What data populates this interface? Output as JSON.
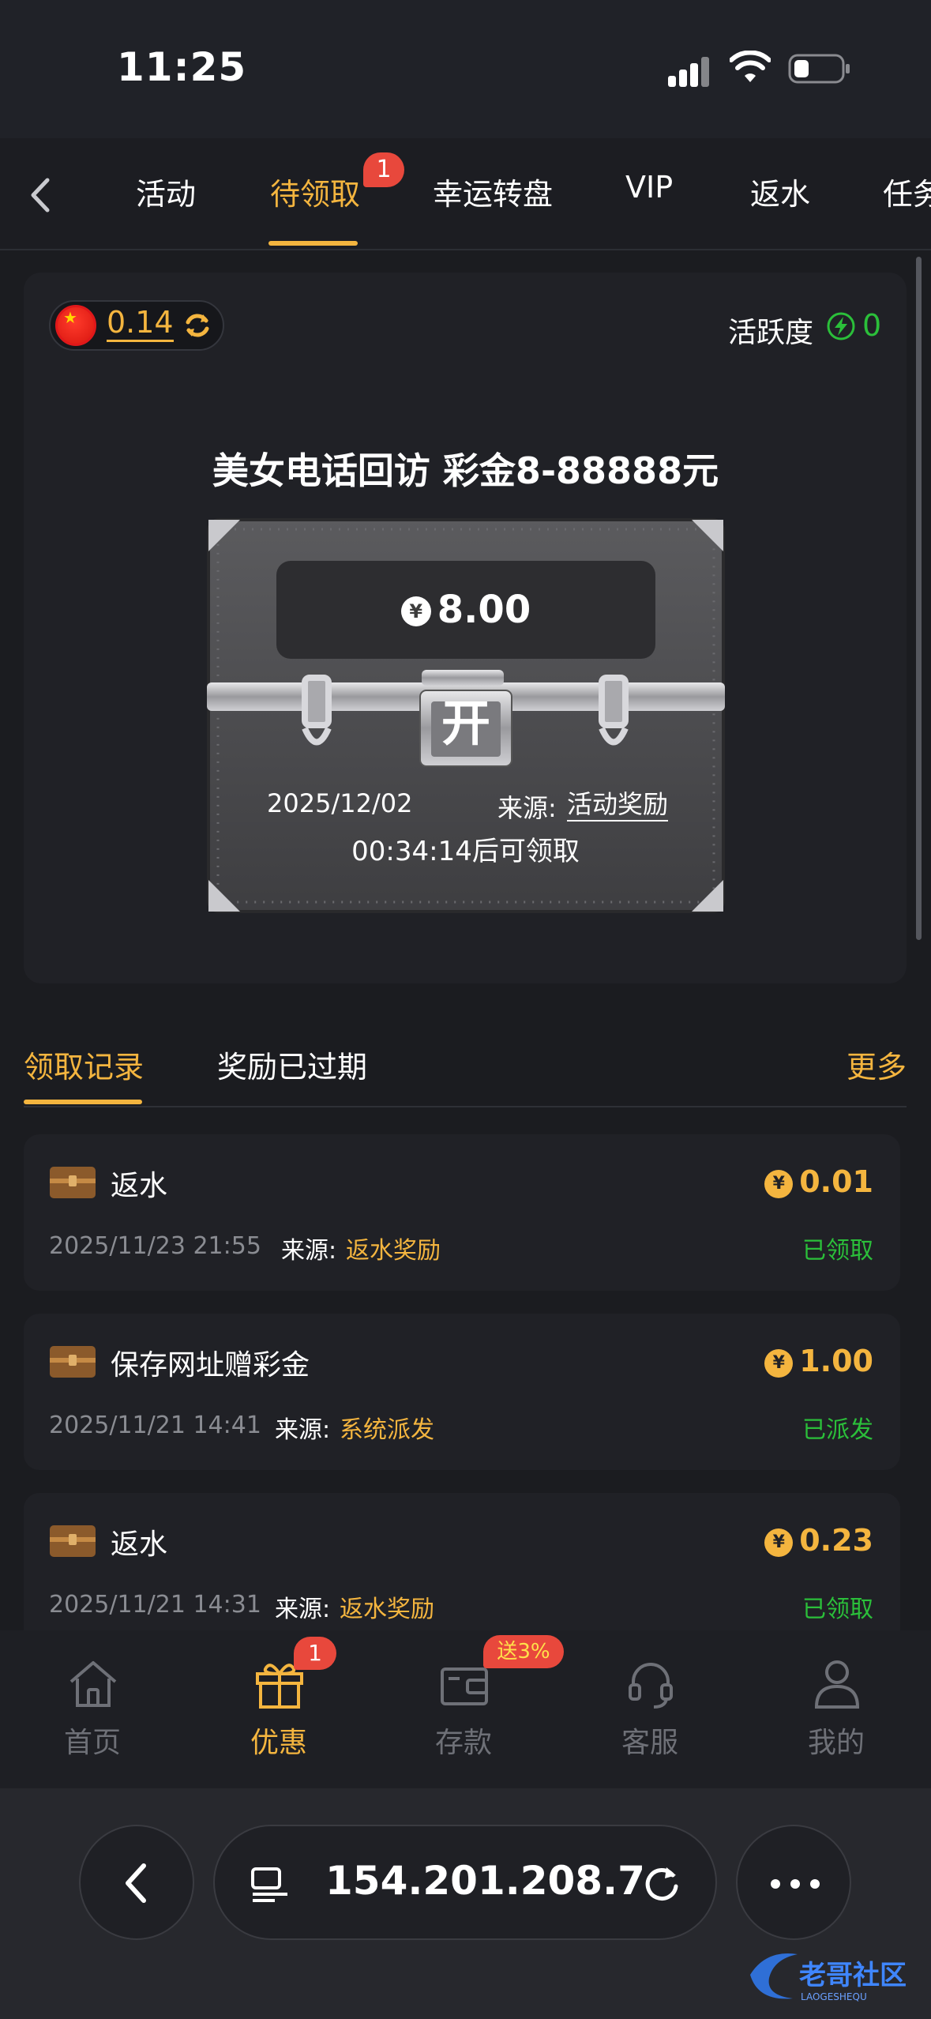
{
  "status_bar": {
    "time": "11:25"
  },
  "nav": {
    "tabs": [
      {
        "label": "活动"
      },
      {
        "label": "待领取",
        "badge": "1",
        "active": true
      },
      {
        "label": "幸运转盘"
      },
      {
        "label": "VIP"
      },
      {
        "label": "返水"
      },
      {
        "label": "任务"
      }
    ]
  },
  "wallet": {
    "balance": "0.14",
    "activity_label": "活跃度",
    "activity_value": "0"
  },
  "chest": {
    "title": "美女电话回访 彩金8-88888元",
    "currency_symbol": "¥",
    "amount": "8.00",
    "open_label": "开",
    "date": "2025/12/02",
    "source_label": "来源:",
    "source_value": "活动奖励",
    "countdown": "00:34:14后可领取"
  },
  "records_tabs": {
    "claimed": "领取记录",
    "expired": "奖励已过期",
    "more": "更多"
  },
  "records": [
    {
      "title": "返水",
      "amount": "0.01",
      "time": "2025/11/23 21:55",
      "source_label": "来源:",
      "source_value": "返水奖励",
      "status": "已领取"
    },
    {
      "title": "保存网址赠彩金",
      "amount": "1.00",
      "time": "2025/11/21 14:41",
      "source_label": "来源:",
      "source_value": "系统派发",
      "status": "已派发"
    },
    {
      "title": "返水",
      "amount": "0.23",
      "time": "2025/11/21 14:31",
      "source_label": "来源:",
      "source_value": "返水奖励",
      "status": "已领取"
    }
  ],
  "bottom_nav": {
    "items": [
      {
        "label": "首页"
      },
      {
        "label": "优惠",
        "badge": "1",
        "active": true
      },
      {
        "label": "存款",
        "promo": "送3%"
      },
      {
        "label": "客服"
      },
      {
        "label": "我的"
      }
    ]
  },
  "browser": {
    "url": "154.201.208.7"
  },
  "colors": {
    "accent": "#f4b53f",
    "success": "#2bbf3a",
    "badge": "#e8483c",
    "background": "#1b1c20"
  }
}
